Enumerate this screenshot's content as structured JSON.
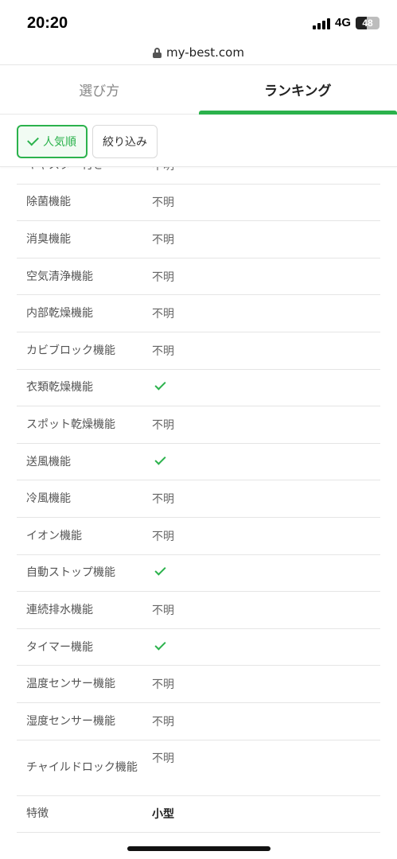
{
  "status_bar": {
    "time": "20:20",
    "network": "4G",
    "battery_percent": "48",
    "battery_level": 0.48,
    "signal_bars": 4
  },
  "browser": {
    "url": "my-best.com"
  },
  "tabs": [
    {
      "label": "選び方",
      "active": false
    },
    {
      "label": "ランキング",
      "active": true
    }
  ],
  "filters": {
    "sort_label": "人気順",
    "filter_label": "絞り込み"
  },
  "specs": [
    {
      "label": "キャスター付き",
      "value": "不明"
    },
    {
      "label": "除菌機能",
      "value": "不明"
    },
    {
      "label": "消臭機能",
      "value": "不明"
    },
    {
      "label": "空気清浄機能",
      "value": "不明"
    },
    {
      "label": "内部乾燥機能",
      "value": "不明"
    },
    {
      "label": "カビブロック機能",
      "value": "不明"
    },
    {
      "label": "衣類乾燥機能",
      "value": "check"
    },
    {
      "label": "スポット乾燥機能",
      "value": "不明"
    },
    {
      "label": "送風機能",
      "value": "check"
    },
    {
      "label": "冷風機能",
      "value": "不明"
    },
    {
      "label": "イオン機能",
      "value": "不明"
    },
    {
      "label": "自動ストップ機能",
      "value": "check"
    },
    {
      "label": "連続排水機能",
      "value": "不明"
    },
    {
      "label": "タイマー機能",
      "value": "check"
    },
    {
      "label": "温度センサー機能",
      "value": "不明"
    },
    {
      "label": "湿度センサー機能",
      "value": "不明"
    },
    {
      "label": "チャイルドロック機能",
      "value": "不明"
    },
    {
      "label": "特徴",
      "value": "小型"
    }
  ],
  "colors": {
    "accent": "#2bb24c"
  }
}
